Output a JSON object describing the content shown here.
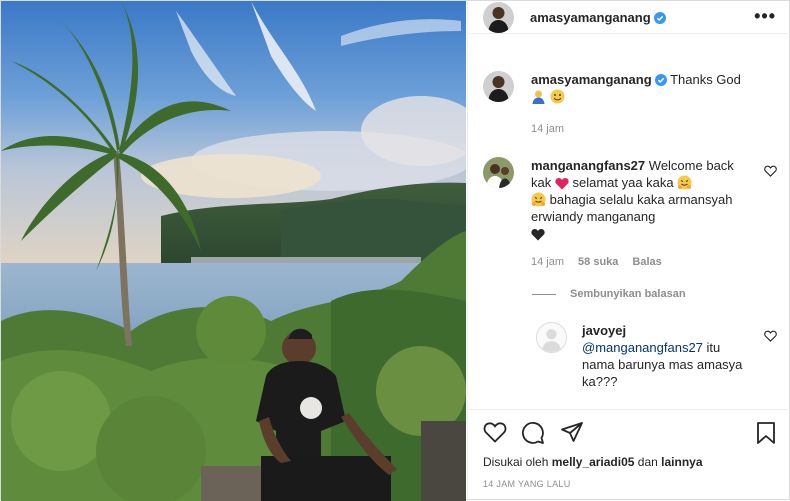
{
  "post": {
    "username": "amasyamanganang",
    "more_icon": "more-horizontal-icon"
  },
  "caption": {
    "username": "amasyamanganang",
    "text": "Thanks God",
    "emojis": [
      "person-emoji",
      "smiling-face-emoji"
    ],
    "time": "14 jam"
  },
  "comments": [
    {
      "username": "manganangfans27",
      "text_1": "Welcome back kak",
      "text_2": "selamat yaa kaka",
      "text_3": "bahagia selalu kaka armansyah erwiandy manganang",
      "time": "14 jam",
      "likes": "58 suka",
      "reply": "Balas",
      "emojis": [
        "red-heart-emoji",
        "hugging-face-emoji",
        "hugging-face-emoji",
        "black-heart-emoji"
      ]
    }
  ],
  "hide_replies": "Sembunyikan balasan",
  "reply": {
    "username": "javoyej",
    "mention": "@manganangfans27",
    "text": "itu nama barunya mas amasya ka???"
  },
  "actions": {
    "icons": [
      "heart-icon",
      "comment-icon",
      "share-icon",
      "bookmark-icon"
    ]
  },
  "liked_by": {
    "prefix": "Disukai oleh",
    "user": "melly_ariadi05",
    "conj": "dan",
    "others": "lainnya"
  },
  "timestamp": "14 JAM YANG LALU",
  "colors": {
    "verified": "#3897f0",
    "text": "#262626",
    "muted": "#8e8e8e",
    "border": "#dbdbdb"
  }
}
